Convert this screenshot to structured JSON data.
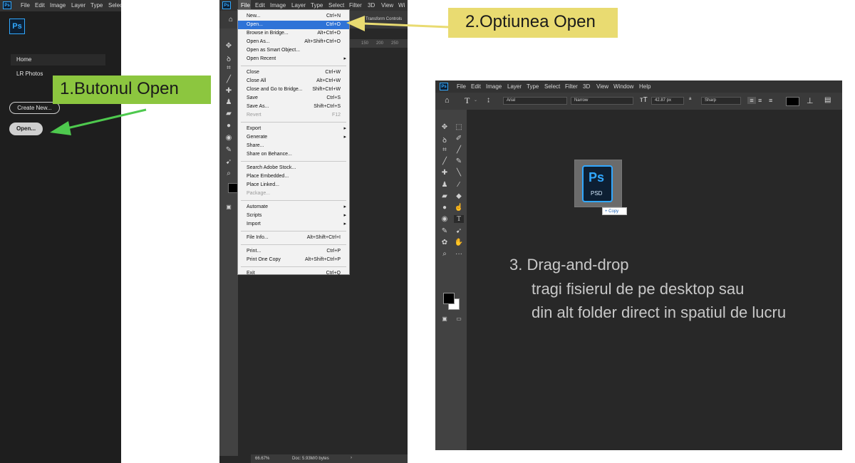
{
  "panel1": {
    "app_logo": "Ps",
    "menu": [
      "File",
      "Edit",
      "Image",
      "Layer",
      "Type",
      "Select"
    ],
    "nav": [
      "Home",
      "LR Photos"
    ],
    "create_new_label": "Create New...",
    "open_label": "Open..."
  },
  "callout1": "1.Butonul Open",
  "callout2": "2.Optiunea Open",
  "panel2": {
    "app_logo": "Ps",
    "menu": [
      "File",
      "Edit",
      "Image",
      "Layer",
      "Type",
      "Select",
      "Filter",
      "3D",
      "View",
      "Wi"
    ],
    "options_text": "Transform Controls",
    "ruler_ticks": [
      "150",
      "200",
      "250"
    ],
    "status_zoom": "66.67%",
    "status_doc": "Doc: 5.93M/0 bytes",
    "file_menu": [
      {
        "label": "New...",
        "shortcut": "Ctrl+N"
      },
      {
        "label": "Open...",
        "shortcut": "Ctrl+O",
        "highlight": true
      },
      {
        "label": "Browse in Bridge...",
        "shortcut": "Alt+Ctrl+O"
      },
      {
        "label": "Open As...",
        "shortcut": "Alt+Shift+Ctrl+O"
      },
      {
        "label": "Open as Smart Object...",
        "shortcut": ""
      },
      {
        "label": "Open Recent",
        "shortcut": "",
        "submenu": true,
        "sep_after": true
      },
      {
        "label": "Close",
        "shortcut": "Ctrl+W"
      },
      {
        "label": "Close All",
        "shortcut": "Alt+Ctrl+W"
      },
      {
        "label": "Close and Go to Bridge...",
        "shortcut": "Shift+Ctrl+W"
      },
      {
        "label": "Save",
        "shortcut": "Ctrl+S"
      },
      {
        "label": "Save As...",
        "shortcut": "Shift+Ctrl+S"
      },
      {
        "label": "Revert",
        "shortcut": "F12",
        "disabled": true,
        "sep_after": true
      },
      {
        "label": "Export",
        "shortcut": "",
        "submenu": true
      },
      {
        "label": "Generate",
        "shortcut": "",
        "submenu": true
      },
      {
        "label": "Share...",
        "shortcut": ""
      },
      {
        "label": "Share on Behance...",
        "shortcut": "",
        "sep_after": true
      },
      {
        "label": "Search Adobe Stock...",
        "shortcut": ""
      },
      {
        "label": "Place Embedded...",
        "shortcut": ""
      },
      {
        "label": "Place Linked...",
        "shortcut": ""
      },
      {
        "label": "Package...",
        "shortcut": "",
        "disabled": true,
        "sep_after": true
      },
      {
        "label": "Automate",
        "shortcut": "",
        "submenu": true
      },
      {
        "label": "Scripts",
        "shortcut": "",
        "submenu": true
      },
      {
        "label": "Import",
        "shortcut": "",
        "submenu": true,
        "sep_after": true
      },
      {
        "label": "File Info...",
        "shortcut": "Alt+Shift+Ctrl+I",
        "sep_after": true
      },
      {
        "label": "Print...",
        "shortcut": "Ctrl+P"
      },
      {
        "label": "Print One Copy",
        "shortcut": "Alt+Shift+Ctrl+P",
        "sep_after": true
      },
      {
        "label": "Exit",
        "shortcut": "Ctrl+Q"
      }
    ]
  },
  "panel3": {
    "app_logo": "Ps",
    "menu": [
      "File",
      "Edit",
      "Image",
      "Layer",
      "Type",
      "Select",
      "Filter",
      "3D",
      "View",
      "Window",
      "Help"
    ],
    "font_family": "Arial",
    "font_style": "Narrow",
    "font_size": "42.87 px",
    "antialias": "Sharp",
    "psd_label": "Ps",
    "psd_ext": "PSD",
    "copy_badge": "+ Copy",
    "instructions": [
      "3.  Drag-and-drop",
      "tragi fisierul de pe desktop sau",
      "din alt folder direct in spatiul de lucru"
    ]
  },
  "colors": {
    "arrow_green": "#4ec94e",
    "arrow_yellow": "#e9db71",
    "ps_blue": "#31a8ff",
    "menu_highlight": "#2f73d7"
  }
}
